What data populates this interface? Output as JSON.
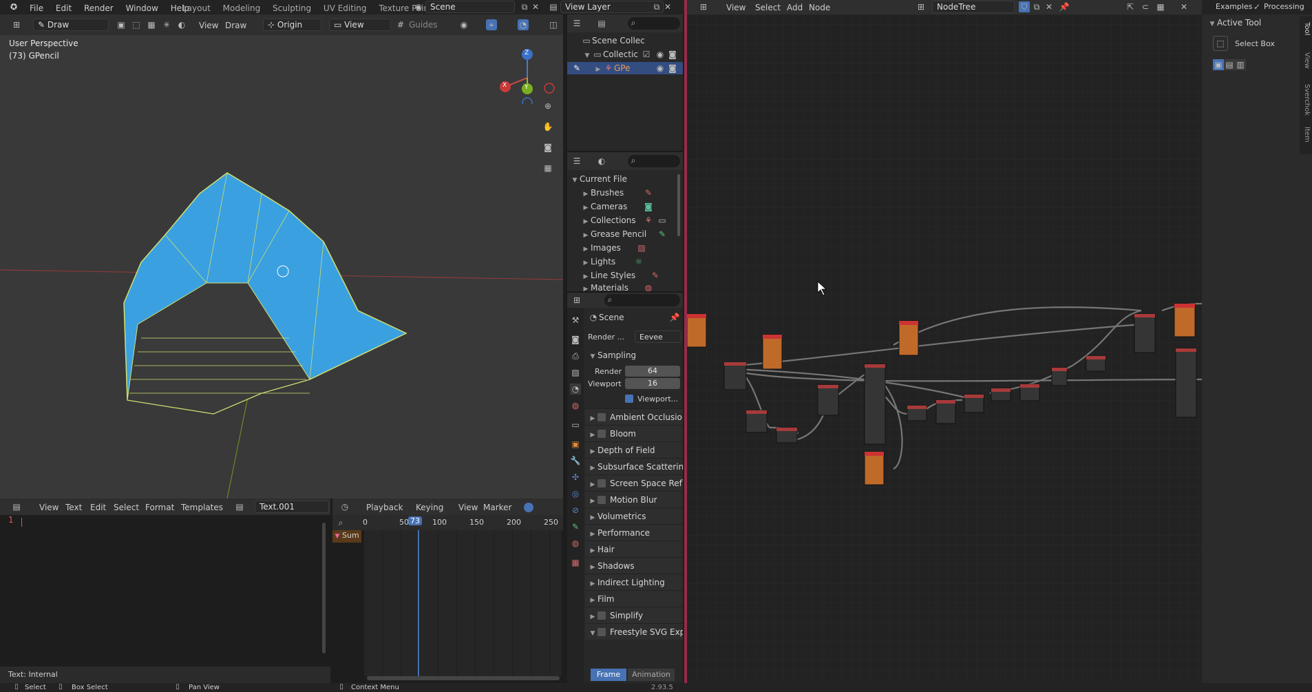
{
  "topbar": {
    "menus": [
      "File",
      "Edit",
      "Render",
      "Window",
      "Help"
    ],
    "workspaces": [
      "Layout",
      "Modeling",
      "Sculpting",
      "UV Editing",
      "Texture Paint"
    ],
    "scene": "Scene",
    "view_layer": "View Layer"
  },
  "viewport": {
    "mode": "Draw",
    "menus": [
      "View",
      "Draw"
    ],
    "origin": "Origin",
    "view_dd": "View",
    "guides": "Guides",
    "overlay_title": "User Perspective",
    "overlay_object": "(73) GPencil",
    "axes": {
      "x": "X",
      "y": "Y",
      "z": "Z"
    }
  },
  "text_editor": {
    "menus": [
      "View",
      "Text",
      "Edit",
      "Select",
      "Format",
      "Templates"
    ],
    "file": "Text.001",
    "line_number": "1",
    "footer": "Text: Internal"
  },
  "timeline": {
    "menus": [
      "Playback",
      "Keying",
      "View",
      "Marker"
    ],
    "ticks": [
      "0",
      "50",
      "100",
      "150",
      "200",
      "250"
    ],
    "current_frame": "73",
    "summary": "Sum"
  },
  "outliner": {
    "scene_collection": "Scene Collec",
    "collection": "Collectic",
    "object": "GPe"
  },
  "file_browser": {
    "current_file": "Current File",
    "items": [
      "Brushes",
      "Cameras",
      "Collections",
      "Grease Pencil",
      "Images",
      "Lights",
      "Line Styles",
      "Materials"
    ]
  },
  "properties": {
    "context": "Scene",
    "render_label": "Render ...",
    "render_engine": "Eevee",
    "sampling": "Sampling",
    "render_samples_label": "Render",
    "render_samples": "64",
    "viewport_samples_label": "Viewport",
    "viewport_samples": "16",
    "viewport_denoise": "Viewport...",
    "panels": [
      {
        "label": "Ambient Occlusion",
        "checkbox": true
      },
      {
        "label": "Bloom",
        "checkbox": true
      },
      {
        "label": "Depth of Field",
        "checkbox": false
      },
      {
        "label": "Subsurface Scattering",
        "checkbox": false
      },
      {
        "label": "Screen Space Refle",
        "checkbox": true
      },
      {
        "label": "Motion Blur",
        "checkbox": true
      },
      {
        "label": "Volumetrics",
        "checkbox": false
      },
      {
        "label": "Performance",
        "checkbox": false
      },
      {
        "label": "Hair",
        "checkbox": false
      },
      {
        "label": "Shadows",
        "checkbox": false
      },
      {
        "label": "Indirect Lighting",
        "checkbox": false
      },
      {
        "label": "Film",
        "checkbox": false
      },
      {
        "label": "Simplify",
        "checkbox": true
      },
      {
        "label": "Freestyle SVG Expo",
        "checkbox": true
      }
    ],
    "tab_frame": "Frame",
    "tab_animation": "Animation"
  },
  "node_editor": {
    "menus": [
      "View",
      "Select",
      "Add",
      "Node"
    ],
    "tree": "NodeTree",
    "examples": "Examples",
    "processing": "Processing"
  },
  "sidebar": {
    "panel": "Active Tool",
    "tool": "Select Box",
    "tabs": [
      "Tool",
      "View",
      "Sverchok",
      "Item"
    ]
  },
  "statusbar": {
    "select": "Select",
    "box_select": "Box Select",
    "pan_view": "Pan View",
    "context_menu": "Context Menu",
    "version": "2.93.5"
  }
}
